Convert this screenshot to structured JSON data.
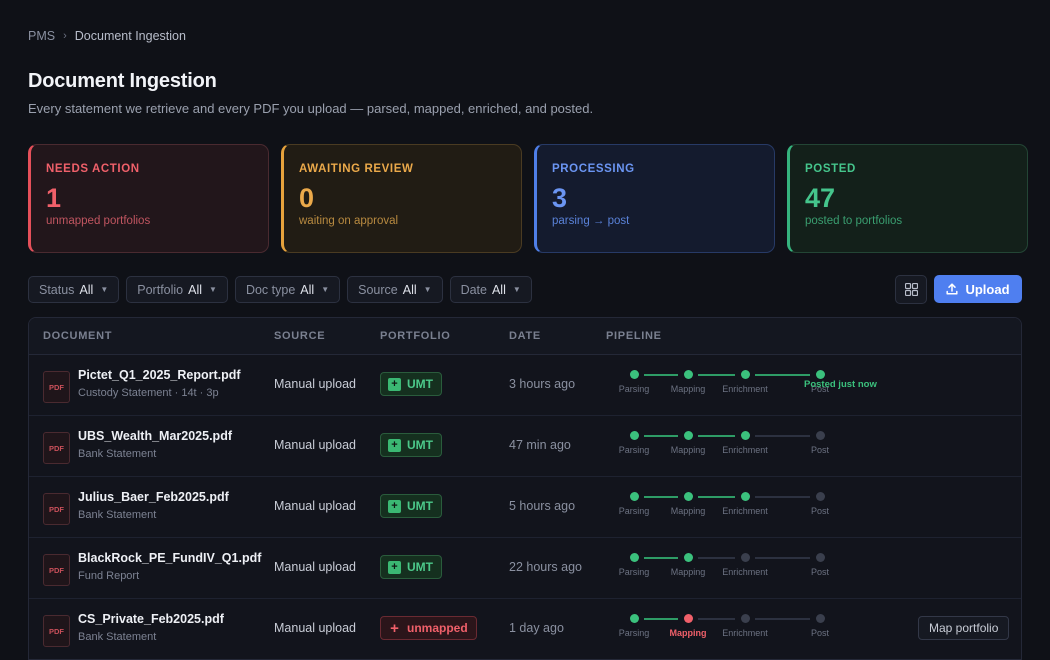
{
  "breadcrumb": {
    "root": "PMS",
    "separator": "›",
    "current": "Document Ingestion"
  },
  "page": {
    "title": "Document Ingestion",
    "subtitle": "Every statement we retrieve and every PDF you upload — parsed, mapped, enriched, and posted."
  },
  "summary_cards": [
    {
      "label": "NEEDS ACTION",
      "count": "1",
      "sub": "unmapped portfolios"
    },
    {
      "label": "AWAITING REVIEW",
      "count": "0",
      "sub": "waiting on approval"
    },
    {
      "label": "PROCESSING",
      "count": "3",
      "sub": "parsing → post"
    },
    {
      "label": "POSTED",
      "count": "47",
      "sub": "posted to portfolios"
    }
  ],
  "filters": [
    {
      "label": "Status",
      "value": "All"
    },
    {
      "label": "Portfolio",
      "value": "All"
    },
    {
      "label": "Doc type",
      "value": "All"
    },
    {
      "label": "Source",
      "value": "All"
    },
    {
      "label": "Date",
      "value": "All"
    }
  ],
  "toolbar": {
    "upload_label": "Upload"
  },
  "table": {
    "headers": {
      "document": "DOCUMENT",
      "source": "SOURCE",
      "portfolio": "PORTFOLIO",
      "date": "DATE",
      "pipeline": "PIPELINE"
    },
    "pdf_label": "PDF",
    "pipeline_steps": [
      "Parsing",
      "Mapping",
      "Enrichment",
      "Post"
    ],
    "rows": [
      {
        "name": "Pictet_Q1_2025_Report.pdf",
        "type": "Custody Statement · 14t · 3p",
        "source": "Manual upload",
        "portfolio": "UMT",
        "portfolio_state": "ok",
        "date": "3 hours ago",
        "steps": [
          "done",
          "done",
          "done",
          "done"
        ],
        "note": "Posted just now",
        "action": ""
      },
      {
        "name": "UBS_Wealth_Mar2025.pdf",
        "type": "Bank Statement",
        "source": "Manual upload",
        "portfolio": "UMT",
        "portfolio_state": "ok",
        "date": "47 min ago",
        "steps": [
          "done",
          "done",
          "done",
          "pending"
        ],
        "note": "",
        "action": ""
      },
      {
        "name": "Julius_Baer_Feb2025.pdf",
        "type": "Bank Statement",
        "source": "Manual upload",
        "portfolio": "UMT",
        "portfolio_state": "ok",
        "date": "5 hours ago",
        "steps": [
          "done",
          "done",
          "done",
          "pending"
        ],
        "note": "",
        "action": ""
      },
      {
        "name": "BlackRock_PE_FundIV_Q1.pdf",
        "type": "Fund Report",
        "source": "Manual upload",
        "portfolio": "UMT",
        "portfolio_state": "ok",
        "date": "22 hours ago",
        "steps": [
          "done",
          "done",
          "pending",
          "pending"
        ],
        "note": "",
        "action": ""
      },
      {
        "name": "CS_Private_Feb2025.pdf",
        "type": "Bank Statement",
        "source": "Manual upload",
        "portfolio": "unmapped",
        "portfolio_state": "bad",
        "date": "1 day ago",
        "steps": [
          "done",
          "err",
          "pending",
          "pending"
        ],
        "note": "",
        "action": "Map portfolio"
      }
    ]
  },
  "colors": {
    "accent": "#4f7ff0",
    "success": "#3bc17d",
    "danger": "#f0606a",
    "warning": "#eba94a"
  }
}
